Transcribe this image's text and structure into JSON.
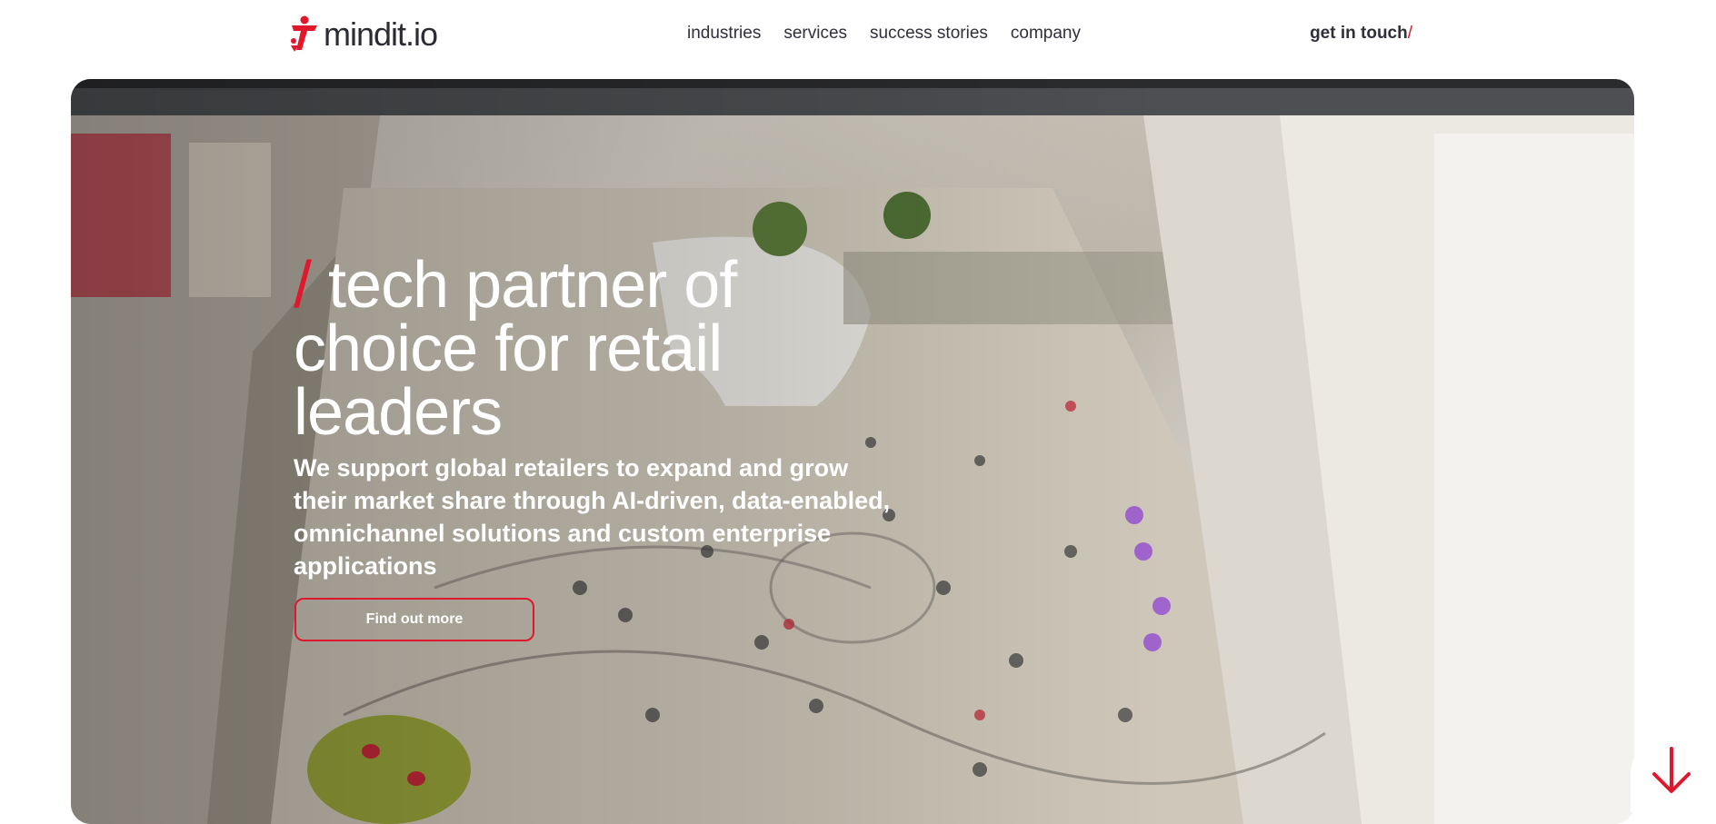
{
  "brand": {
    "name": "mindit.io",
    "accent": "#e0182d",
    "text_color": "#2f2f3a"
  },
  "nav": {
    "items": [
      {
        "label": "industries"
      },
      {
        "label": "services"
      },
      {
        "label": "success stories"
      },
      {
        "label": "company"
      }
    ],
    "cta_label": "get in touch",
    "cta_slash": "/"
  },
  "hero": {
    "title_slash": "/",
    "title": "tech partner of choice for retail leaders",
    "subtitle": "We support global retailers to expand and grow their market share through AI-driven, data-enabled, omnichannel solutions and custom enterprise applications",
    "button_label": "Find out more",
    "scroll_icon": "arrow-down-icon"
  }
}
